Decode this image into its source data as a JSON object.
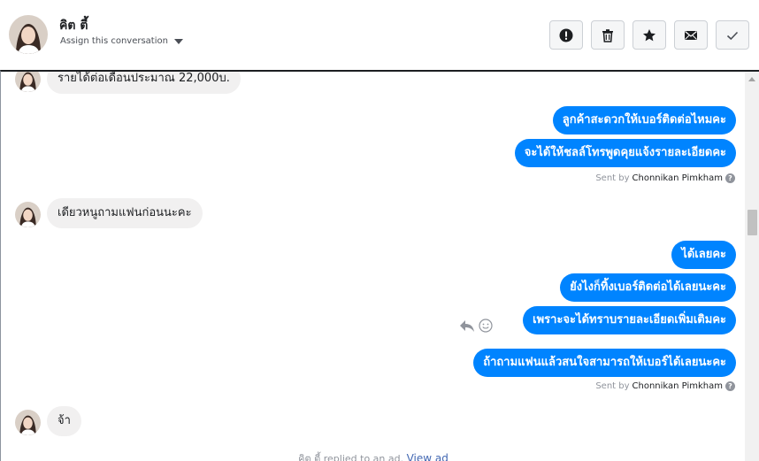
{
  "header": {
    "contact_name": "คิต ตี้",
    "assign_label": "Assign this conversation",
    "actions": [
      {
        "icon": "alert-icon",
        "title": "Mark as spam"
      },
      {
        "icon": "trash-icon",
        "title": "Delete"
      },
      {
        "icon": "star-icon",
        "title": "Follow up"
      },
      {
        "icon": "envelope-icon",
        "title": "Mark as unread"
      },
      {
        "icon": "check-icon",
        "title": "Mark as done"
      }
    ]
  },
  "messages": {
    "in_1": "รายได้ต่อเดือนประมาณ 22,000บ.",
    "out_1": "ลูกค้าสะดวกให้เบอร์ติดต่อไหมคะ",
    "out_2": "จะได้ให้ชลล์โทรพูดคุยแจ้งรายละเอียดคะ",
    "in_2": "เดียวหนูถามแฟนก่อนนะคะ",
    "out_3": "ได้เลยคะ",
    "out_4": "ยังไงก็ทิ้งเบอร์ติดต่อได้เลยนะคะ",
    "out_5": "เพราะจะได้ทราบรายละเอียดเพิ่มเติมคะ",
    "out_6": "ถ้าถามแฟนแล้วสนใจสามารถให้เบอร์ได้เลยนะคะ",
    "in_3": "จ้า"
  },
  "sent_by": {
    "prefix": "Sent by",
    "name": "Chonnikan Pimkham"
  },
  "footer": {
    "text": "คิต ตี้ replied to an ad.",
    "link": "View ad"
  },
  "colors": {
    "outgoing_bubble": "#0084ff",
    "incoming_bubble": "#f1f0f0",
    "link": "#4267b2"
  }
}
